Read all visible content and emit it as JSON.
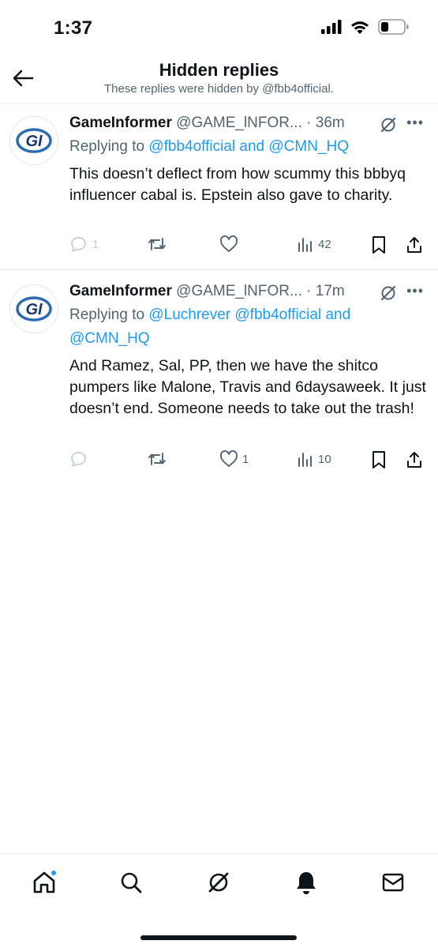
{
  "status_bar": {
    "time": "1:37",
    "icons": [
      "cellular-signal-icon",
      "wifi-icon",
      "battery-icon"
    ]
  },
  "header": {
    "title": "Hidden replies",
    "subtitle": "These replies were hidden by @fbb4official."
  },
  "tweets": [
    {
      "author_name": "GameInformer",
      "author_handle": "@GAME_lNFOR...",
      "time": "· 36m",
      "replying_prefix": "Replying to ",
      "replying_mentions": "@fbb4official and @CMN_HQ",
      "replying_line2": "",
      "text": "This doesn’t deflect from how scummy this bbbyq influencer cabal is.  Epstein also gave to charity.",
      "replies": "1",
      "retweets": "",
      "likes": "",
      "views": "42"
    },
    {
      "author_name": "GameInformer",
      "author_handle": "@GAME_lNFOR...",
      "time": "· 17m",
      "replying_prefix": "Replying to ",
      "replying_mentions": "@Luchrever @fbb4official and",
      "replying_line2": "@CMN_HQ",
      "text": "And Ramez, Sal, PP, then we have the shitco pumpers like Malone, Travis and 6daysaweek. It just doesn’t end. Someone needs to take out the trash!",
      "replies": "",
      "retweets": "",
      "likes": "1",
      "views": "10"
    }
  ],
  "avatar_text": "GI",
  "colors": {
    "accent": "#1d9bf0",
    "text": "#0f1419",
    "secondary": "#536471",
    "avatar_blue": "#2b6cb0"
  },
  "bottom_nav": [
    "home-icon",
    "search-icon",
    "grok-icon",
    "notifications-icon",
    "messages-icon"
  ]
}
